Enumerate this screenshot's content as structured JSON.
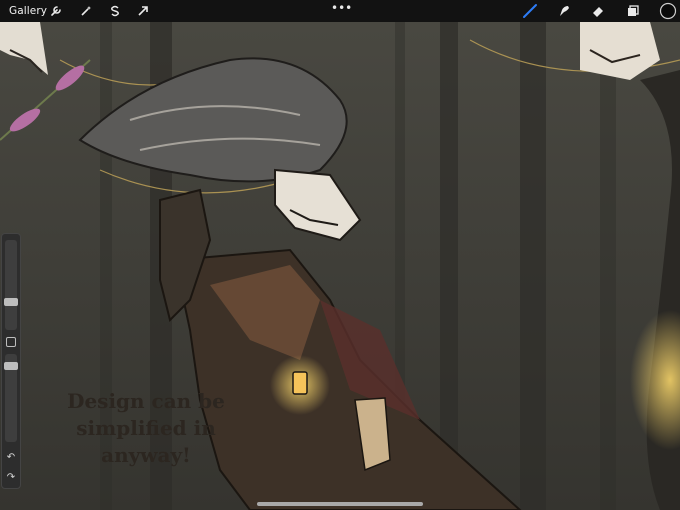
{
  "app": {
    "gallery_label": "Gallery",
    "toolbar": {
      "actions": [
        "wrench-icon",
        "magic-wand-icon",
        "selection-s-icon",
        "transform-arrow-icon"
      ],
      "more_label": "•••",
      "tools": [
        "brush-icon",
        "smudge-icon",
        "eraser-icon",
        "layers-icon"
      ],
      "active_color": "#0a0a0a",
      "active_tool_color": "#2d7cf6"
    },
    "sidebar": {
      "brush_size_level": 0.28,
      "brush_opacity_level": 0.3
    }
  },
  "canvas": {
    "caption_line1": "Design can be",
    "caption_line2": "simplified in anyway!"
  }
}
